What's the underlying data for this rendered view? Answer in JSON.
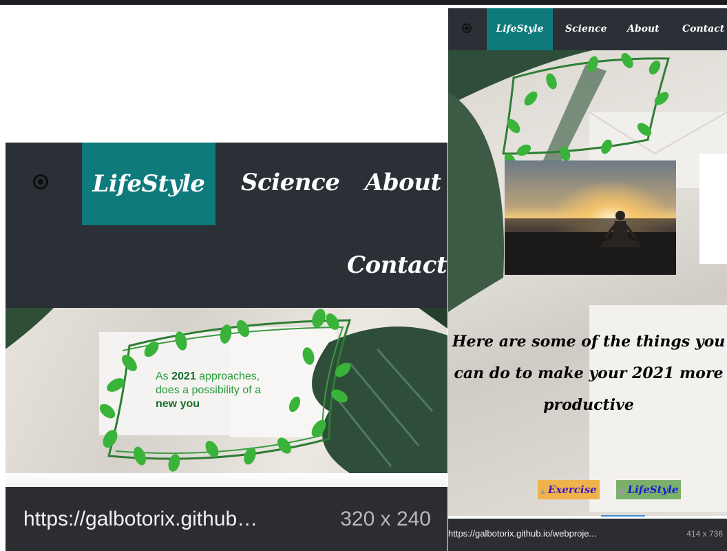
{
  "left_preview": {
    "nav": {
      "items": [
        {
          "label": "LifeStyle",
          "active": true
        },
        {
          "label": "Science",
          "active": false
        },
        {
          "label": "About",
          "active": false
        },
        {
          "label": "Contact",
          "active": false
        }
      ]
    },
    "hero": {
      "line1_prefix": "As ",
      "year": "2021",
      "line1_suffix": " approaches,",
      "line2": "does a possibility of a",
      "line3": "new you"
    },
    "status": {
      "url": "https://galbotorix.github…",
      "size": "320 x 240"
    }
  },
  "right_preview": {
    "nav": {
      "items": [
        {
          "label": "LifeStyle",
          "active": true
        },
        {
          "label": "Science",
          "active": false
        },
        {
          "label": "About",
          "active": false
        },
        {
          "label": "Contact",
          "active": false
        }
      ]
    },
    "heading": "Here are some of the things you can do to make your 2021 more productive",
    "tags": [
      {
        "label": "Exercise",
        "icon": "user-icon"
      },
      {
        "label": "LifeStyle",
        "icon": "folder-icon"
      }
    ],
    "status": {
      "url": "https://galbotorix.github.io/webproje...",
      "size": "414 x 736"
    }
  },
  "colors": {
    "nav_bg": "#2b3036",
    "nav_active": "#0f7a7c",
    "status_bg": "#2b2d30",
    "leaf_green": "#39b339",
    "tag_exercise_bg": "#f0b24a",
    "tag_lifestyle_bg": "#7ab06a"
  }
}
